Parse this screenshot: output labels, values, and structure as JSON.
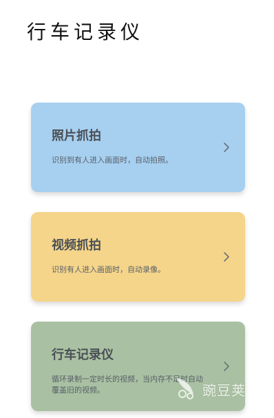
{
  "header": {
    "title": "行车记录仪"
  },
  "cards": [
    {
      "title": "照片抓拍",
      "description": "识别到有人进入画面时，自动拍照。",
      "color": "#A7D0F0"
    },
    {
      "title": "视频抓拍",
      "description": "识别有人进入画面时，自动录像。",
      "color": "#F5D58A"
    },
    {
      "title": "行车记录仪",
      "description": "循环录制一定时长的视频，当内存不足时自动覆盖旧的视频。",
      "color": "#A9C1A2"
    }
  ],
  "watermark": {
    "text": "豌豆荚"
  },
  "icons": {
    "chevron": "chevron-right-icon",
    "watermark_logo": "watermark-logo-icon"
  }
}
